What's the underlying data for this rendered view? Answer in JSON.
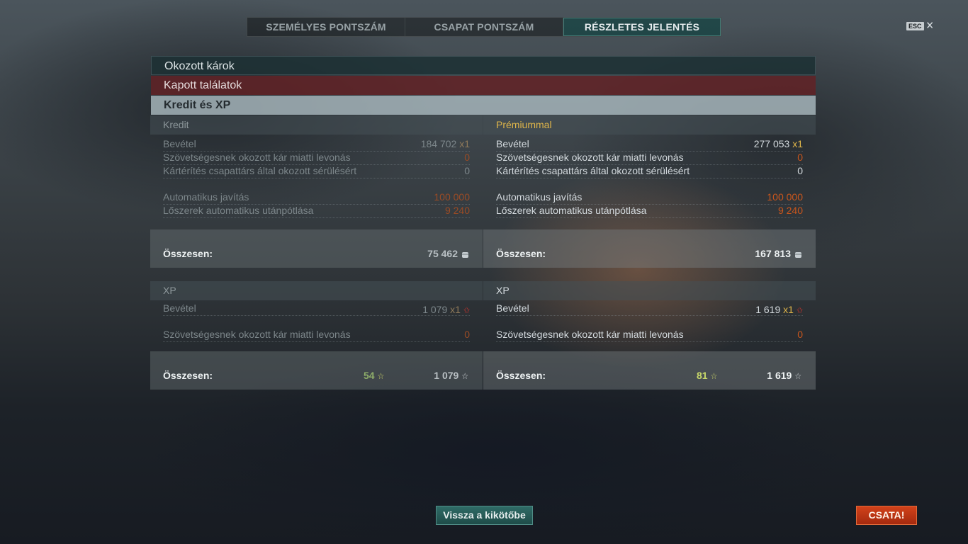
{
  "tabs": [
    {
      "label": "SZEMÉLYES PONTSZÁM",
      "active": false
    },
    {
      "label": "CSAPAT PONTSZÁM",
      "active": false
    },
    {
      "label": "RÉSZLETES JELENTÉS",
      "active": true
    }
  ],
  "esc": {
    "key": "ESC",
    "close": "✕"
  },
  "sections": {
    "damage_dealt": "Okozott károk",
    "hits_received": "Kapott találatok",
    "credit_xp": "Kredit és XP"
  },
  "credits": {
    "left": {
      "header": "Kredit",
      "income_label": "Bevétel",
      "income_value": "184 702",
      "income_mult": "x1",
      "ally_damage_label": "Szövetségesnek okozott kár miatti levonás",
      "ally_damage_value": "0",
      "compensation_label": "Kártérítés csapattárs által okozott sérülésért",
      "compensation_value": "0",
      "repair_label": "Automatikus javítás",
      "repair_value": "100 000",
      "resupply_label": "Lőszerek automatikus utánpótlása",
      "resupply_value": "9 240",
      "total_label": "Összesen:",
      "total_value": "75 462"
    },
    "right": {
      "header": "Prémiummal",
      "income_label": "Bevétel",
      "income_value": "277 053",
      "income_mult": "x1",
      "ally_damage_label": "Szövetségesnek okozott kár miatti levonás",
      "ally_damage_value": "0",
      "compensation_label": "Kártérítés csapattárs által okozott sérülésért",
      "compensation_value": "0",
      "repair_label": "Automatikus javítás",
      "repair_value": "100 000",
      "resupply_label": "Lőszerek automatikus utánpótlása",
      "resupply_value": "9 240",
      "total_label": "Összesen:",
      "total_value": "167 813"
    }
  },
  "xp": {
    "left": {
      "header": "XP",
      "income_label": "Bevétel",
      "income_value": "1 079",
      "income_mult": "x1",
      "ally_damage_label": "Szövetségesnek okozott kár miatti levonás",
      "ally_damage_value": "0",
      "total_label": "Összesen:",
      "free_xp_value": "54",
      "total_value": "1 079"
    },
    "right": {
      "header": "XP",
      "income_label": "Bevétel",
      "income_value": "1 619",
      "income_mult": "x1",
      "ally_damage_label": "Szövetségesnek okozott kár miatti levonás",
      "ally_damage_value": "0",
      "total_label": "Összesen:",
      "free_xp_value": "81",
      "total_value": "1 619"
    }
  },
  "icons": {
    "credit": "credit-coin-icon",
    "xp_elite": "red-star-icon",
    "xp": "white-star-icon",
    "free_xp": "gold-star-icon"
  },
  "buttons": {
    "back": "Vissza a kikötőbe",
    "battle": "CSATA!"
  },
  "colors": {
    "tab_active": "#1e5050",
    "section_damage": "#1c3034",
    "section_hits": "#622226",
    "section_credit_xp": "#a5b4ba",
    "premium": "#e0b64a",
    "deduction": "#c9561c",
    "back_button": "#2f6b66",
    "battle_button": "#d2421a"
  }
}
